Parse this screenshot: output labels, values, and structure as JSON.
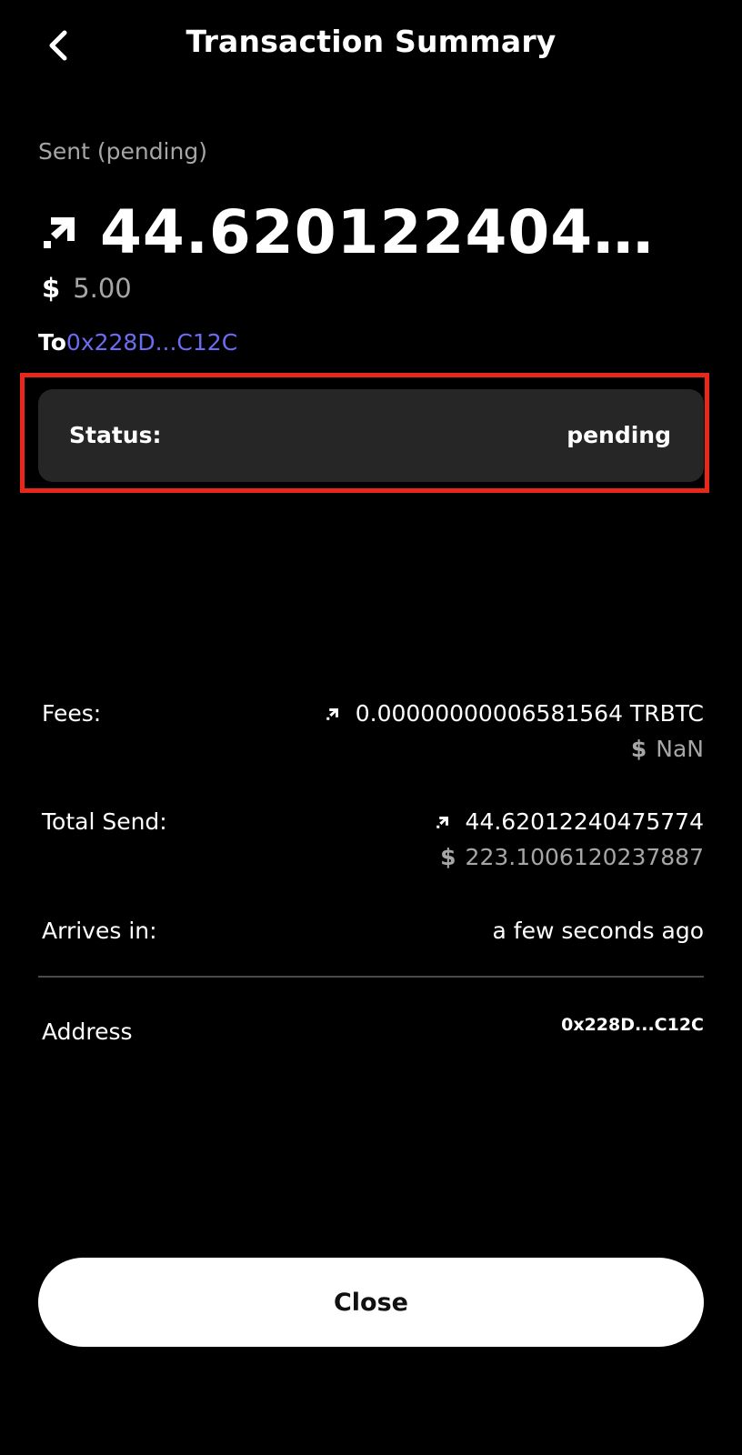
{
  "header": {
    "title": "Transaction Summary",
    "back_icon": "chevron-left-icon"
  },
  "summary": {
    "sent_label": "Sent (pending)",
    "amount": "44.620122404757...",
    "amount_icon": "arrow-up-right-icon",
    "fiat_sign": "$",
    "fiat_value": "5.00",
    "to_label": "To",
    "to_address": "0x228D...C12C",
    "to_address_color": "#6b6cf2"
  },
  "status": {
    "label": "Status:",
    "value": "pending",
    "highlight_color": "#e8281b"
  },
  "details": {
    "fees": {
      "label": "Fees:",
      "value": "0.00000000006581564 TRBTC",
      "fiat_sign": "$",
      "fiat_value": "NaN"
    },
    "total_send": {
      "label": "Total Send:",
      "value": "44.62012240475774",
      "fiat_sign": "$",
      "fiat_value": "223.1006120237887"
    },
    "arrives_in": {
      "label": "Arrives in:",
      "value": "a few seconds ago"
    },
    "address": {
      "label": "Address",
      "value": "0x228D...C12C"
    }
  },
  "close_button": {
    "label": "Close"
  }
}
